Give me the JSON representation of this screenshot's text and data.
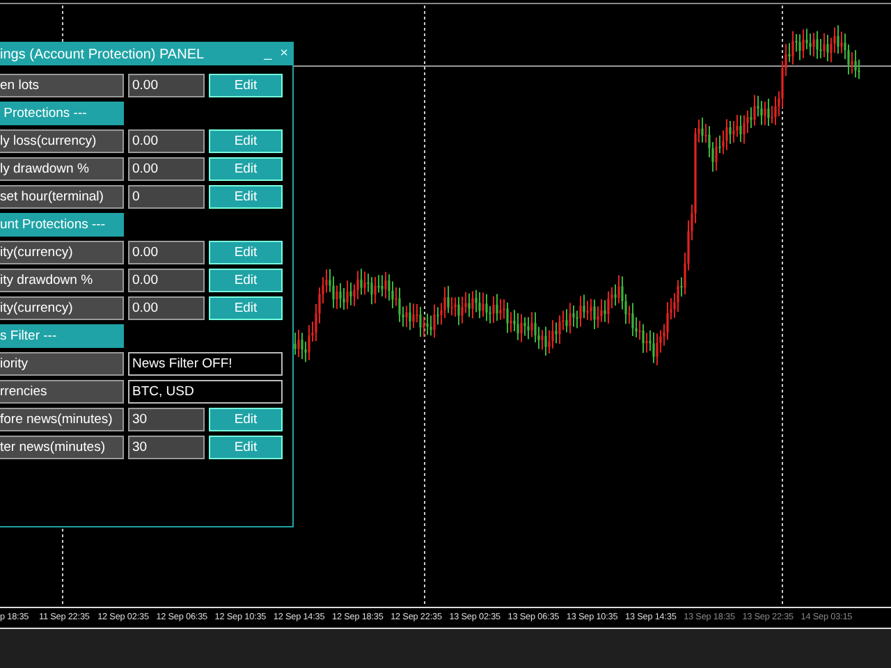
{
  "panel": {
    "title": "ings (Account Protection) PANEL",
    "minimize": "_",
    "close": "×",
    "rows": [
      {
        "kind": "field",
        "label": "en lots",
        "value": "0.00",
        "button": "Edit"
      },
      {
        "kind": "header",
        "label": " Protections ---"
      },
      {
        "kind": "field",
        "label": "ly loss(currency)",
        "value": "0.00",
        "button": "Edit"
      },
      {
        "kind": "field",
        "label": "ly drawdown %",
        "value": "0.00",
        "button": "Edit"
      },
      {
        "kind": "field",
        "label": "set hour(terminal)",
        "value": "0",
        "button": "Edit"
      },
      {
        "kind": "header",
        "label": "unt Protections ---"
      },
      {
        "kind": "field",
        "label": "ity(currency)",
        "value": "0.00",
        "button": "Edit"
      },
      {
        "kind": "field",
        "label": "ity drawdown %",
        "value": "0.00",
        "button": "Edit"
      },
      {
        "kind": "field",
        "label": "ity(currency)",
        "value": "0.00",
        "button": "Edit"
      },
      {
        "kind": "header",
        "label": "s Filter ---"
      },
      {
        "kind": "display",
        "label": "iority",
        "value": "News Filter OFF!"
      },
      {
        "kind": "display",
        "label": "rrencies",
        "value": "BTC, USD"
      },
      {
        "kind": "field",
        "label": "fore news(minutes)",
        "value": "30",
        "button": "Edit"
      },
      {
        "kind": "field",
        "label": "ter news(minutes)",
        "value": "30",
        "button": "Edit"
      }
    ]
  },
  "time_axis": [
    "p 18:35",
    "11 Sep 22:35",
    "12 Sep 02:35",
    "12 Sep 06:35",
    "12 Sep 10:35",
    "12 Sep 14:35",
    "12 Sep 18:35",
    "12 Sep 22:35",
    "13 Sep 02:35",
    "13 Sep 06:35",
    "13 Sep 10:35",
    "13 Sep 14:35",
    "13 Sep 18:35",
    "13 Sep 22:35",
    "14 Sep 03:15"
  ]
}
